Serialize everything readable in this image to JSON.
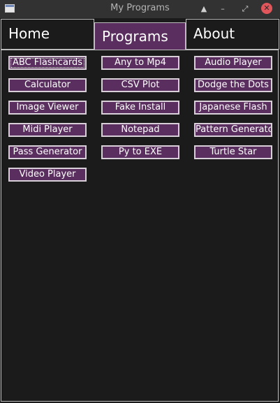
{
  "window": {
    "title": "My Programs"
  },
  "tabs": [
    {
      "label": "Home"
    },
    {
      "label": "Programs"
    },
    {
      "label": "About"
    }
  ],
  "programs": {
    "col1": [
      "ABC Flashcards",
      "Calculator",
      "Image Viewer",
      "Midi Player",
      "Pass Generator",
      "Video Player"
    ],
    "col2": [
      "Any to Mp4",
      "CSV Plot",
      "Fake Install",
      "Notepad",
      "Py to EXE"
    ],
    "col3": [
      "Audio Player",
      "Dodge the Dots",
      "Japanese Flash",
      "Pattern Generator",
      "Turtle Star"
    ]
  },
  "colors": {
    "accent": "#5a2f5f",
    "background": "#1c1b1b",
    "close_button": "#e0565b"
  }
}
